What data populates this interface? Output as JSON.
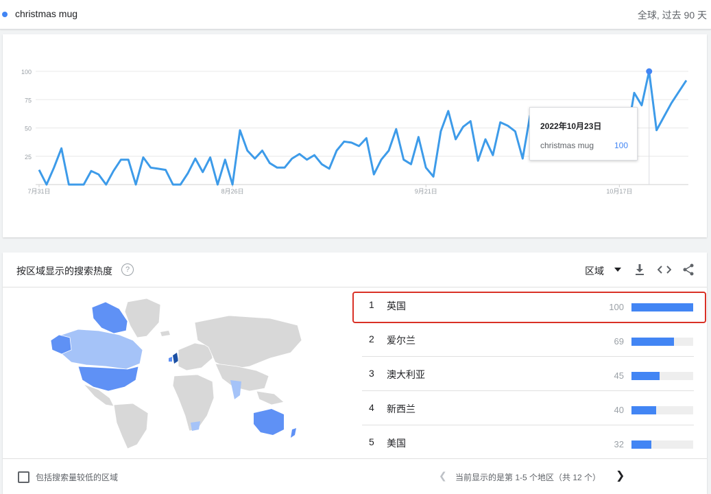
{
  "topbar": {
    "term": "christmas mug",
    "scope": "全球, 过去 90 天"
  },
  "chart_data": {
    "type": "line",
    "series": [
      {
        "name": "christmas mug",
        "values": [
          13,
          0,
          15,
          32,
          0,
          0,
          0,
          12,
          9,
          0,
          12,
          22,
          22,
          0,
          24,
          15,
          14,
          13,
          0,
          0,
          10,
          23,
          11,
          24,
          0,
          22,
          0,
          48,
          30,
          23,
          30,
          19,
          15,
          15,
          23,
          27,
          22,
          26,
          18,
          14,
          30,
          38,
          37,
          34,
          41,
          9,
          22,
          30,
          49,
          22,
          18,
          42,
          15,
          7,
          47,
          65,
          40,
          51,
          56,
          21,
          40,
          26,
          55,
          52,
          47,
          23,
          61,
          38,
          31,
          55,
          52,
          44,
          54,
          42,
          50,
          57,
          53,
          48,
          65,
          42,
          81,
          70,
          100,
          48,
          60,
          72,
          82,
          92
        ]
      }
    ],
    "x_ticks": [
      "7月31日",
      "8月26日",
      "9月21日",
      "10月17日"
    ],
    "y_ticks": [
      25,
      50,
      75,
      100
    ],
    "ylim": [
      0,
      100
    ]
  },
  "tooltip": {
    "date": "2022年10月23日",
    "term": "christmas mug",
    "value": "100"
  },
  "region": {
    "title": "按区域显示的搜索热度",
    "help": "?",
    "dropdown": "区域",
    "rows": [
      {
        "rank": "1",
        "name": "英国",
        "value": "100",
        "pct": 1.0
      },
      {
        "rank": "2",
        "name": "爱尔兰",
        "value": "69",
        "pct": 0.69
      },
      {
        "rank": "3",
        "name": "澳大利亚",
        "value": "45",
        "pct": 0.45
      },
      {
        "rank": "4",
        "name": "新西兰",
        "value": "40",
        "pct": 0.4
      },
      {
        "rank": "5",
        "name": "美国",
        "value": "32",
        "pct": 0.32
      }
    ],
    "footer": {
      "checkbox_label": "包括搜索量较低的区域",
      "pager_text": "当前显示的是第 1-5 个地区（共 12 个）"
    }
  },
  "colors": {
    "line": "#3d9be9",
    "bar": "#4285f4",
    "highlight": "#d93025",
    "map_dark": "#1a4fa3",
    "map_mid": "#5f91f5",
    "map_light": "#a5c3f8",
    "map_gray": "#d8d8d8"
  }
}
